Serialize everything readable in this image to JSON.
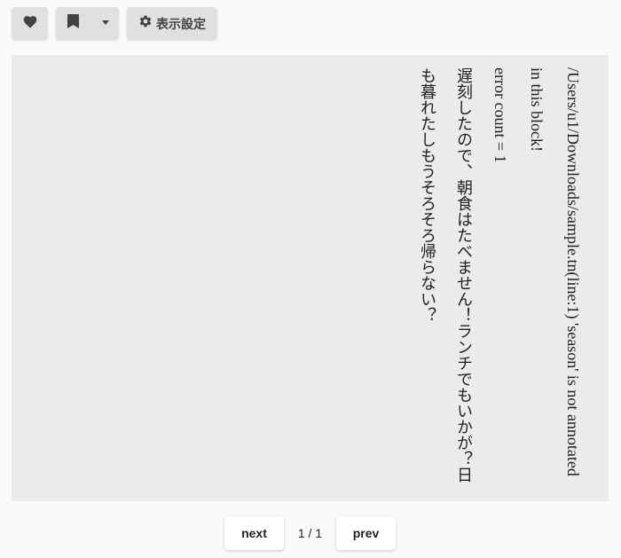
{
  "toolbar": {
    "favorite_icon": "heart-icon",
    "bookmark_icon": "bookmark-icon",
    "settings_icon": "gear-icon",
    "settings_label": "表示設定"
  },
  "reader": {
    "lines": [
      "/Users/u1/Downloads/sample.tn(line:1) 'season' is not annotated in this block!",
      "error count = 1",
      "遅刻したので、朝食はたべません！ランチでもいかが？日も暮れたしもうそろそろ帰らない？"
    ]
  },
  "pager": {
    "next_label": "next",
    "page_indicator": "1 / 1",
    "prev_label": "prev"
  }
}
